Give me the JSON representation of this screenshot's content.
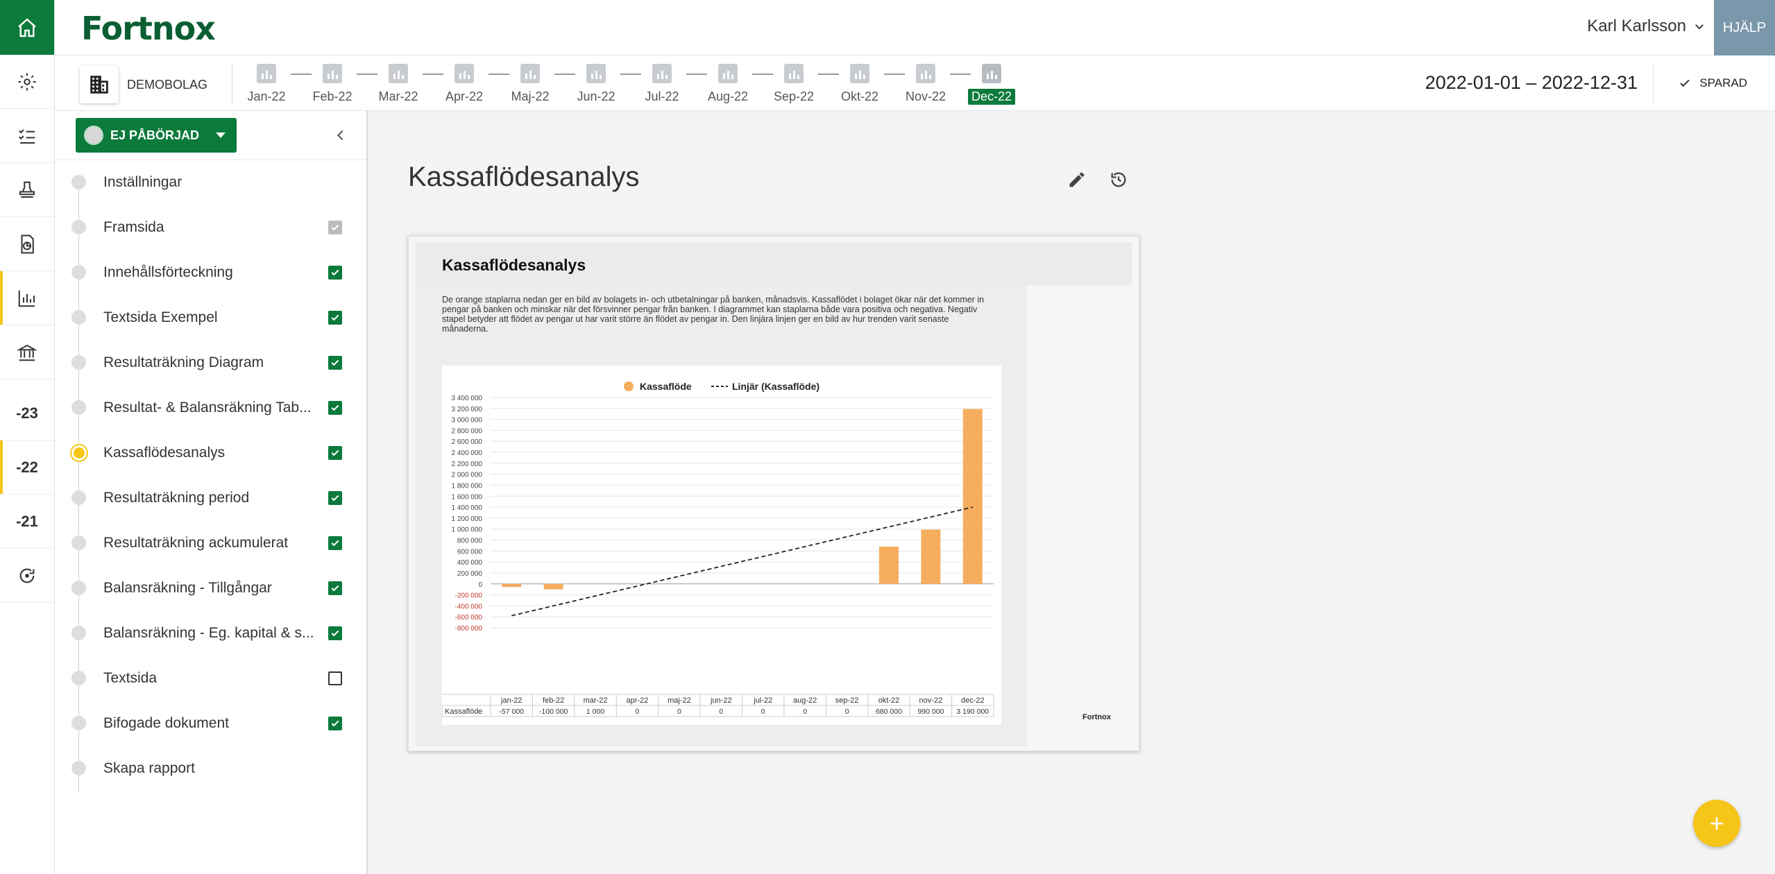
{
  "app": {
    "brand": "Fortnox",
    "user": "Karl Karlsson",
    "help_label": "HJÄLP"
  },
  "rail": {
    "years": [
      "-23",
      "-22",
      "-21"
    ]
  },
  "subbar": {
    "company": "DEMOBOLAG",
    "months": [
      "Jan-22",
      "Feb-22",
      "Mar-22",
      "Apr-22",
      "Maj-22",
      "Jun-22",
      "Jul-22",
      "Aug-22",
      "Sep-22",
      "Okt-22",
      "Nov-22",
      "Dec-22"
    ],
    "active_month": "Dec-22",
    "period": "2022-01-01 – 2022-12-31",
    "saved_label": "SPARAD"
  },
  "panel": {
    "status_label": "EJ PÅBÖRJAD",
    "steps": [
      {
        "label": "Inställningar",
        "check": "none"
      },
      {
        "label": "Framsida",
        "check": "disabled"
      },
      {
        "label": "Innehållsförteckning",
        "check": "on"
      },
      {
        "label": "Textsida Exempel",
        "check": "on"
      },
      {
        "label": "Resultaträkning Diagram",
        "check": "on"
      },
      {
        "label": "Resultat- & Balansräkning Tab...",
        "check": "on"
      },
      {
        "label": "Kassaflödesanalys",
        "check": "on",
        "current": true
      },
      {
        "label": "Resultaträkning period",
        "check": "on"
      },
      {
        "label": "Resultaträkning ackumulerat",
        "check": "on"
      },
      {
        "label": "Balansräkning - Tillgångar",
        "check": "on"
      },
      {
        "label": "Balansräkning - Eg. kapital & s...",
        "check": "on"
      },
      {
        "label": "Textsida",
        "check": "off"
      },
      {
        "label": "Bifogade dokument",
        "check": "on"
      },
      {
        "label": "Skapa rapport",
        "check": "none"
      }
    ]
  },
  "main": {
    "title": "Kassaflödesanalys",
    "preview_title": "Kassaflödesanalys",
    "preview_text": "De orange staplarna nedan ger en bild av bolagets in- och utbetalningar på banken, månadsvis. Kassaflödet i bolaget ökar när det kommer in pengar på banken och minskar när det försvinner pengar från banken. I diagrammet kan staplarna både vara positiva och negativa. Negativ stapel betyder att flödet av pengar ut har varit större än flödet av pengar in. Den linjära linjen ger en bild av hur trenden varit senaste månaderna.",
    "preview_brand": "Fortnox",
    "fab_label": "+"
  },
  "colors": {
    "brand_green": "#0b7a3b",
    "accent_yellow": "#f5c518",
    "bar_orange": "#f6ad5e",
    "help_blue": "#7a97ab",
    "negative_tick": "#c0392b"
  },
  "chart_data": {
    "type": "bar",
    "title": "",
    "categories": [
      "jan-22",
      "feb-22",
      "mar-22",
      "apr-22",
      "maj-22",
      "jun-22",
      "jul-22",
      "aug-22",
      "sep-22",
      "okt-22",
      "nov-22",
      "dec-22"
    ],
    "series": [
      {
        "name": "Kassaflöde",
        "values": [
          -57000,
          -100000,
          1000,
          0,
          0,
          0,
          0,
          0,
          0,
          680000,
          990000,
          3190000
        ]
      },
      {
        "name": "Linjär (Kassaflöde)",
        "type": "line",
        "style": "dashed",
        "values": [
          -580000,
          -400000,
          -220000,
          -40000,
          140000,
          320000,
          500000,
          680000,
          860000,
          1040000,
          1220000,
          1400000
        ]
      }
    ],
    "ylim": [
      -800000,
      3400000
    ],
    "ytick_step": 200000,
    "ytick_labels": [
      "-800 000",
      "-600 000",
      "-400 000",
      "-200 000",
      "0",
      "200 000",
      "400 000",
      "600 000",
      "800 000",
      "1 000 000",
      "1 200 000",
      "1 400 000",
      "1 600 000",
      "1 800 000",
      "2 000 000",
      "2 200 000",
      "2 400 000",
      "2 600 000",
      "2 800 000",
      "3 000 000",
      "3 200 000",
      "3 400 000"
    ],
    "table": {
      "row_label": "Kassaflöde",
      "values": [
        "-57 000",
        "-100 000",
        "1 000",
        "0",
        "0",
        "0",
        "0",
        "0",
        "0",
        "680 000",
        "990 000",
        "3 190 000"
      ]
    },
    "legend_position": "top-center",
    "grid": true
  }
}
